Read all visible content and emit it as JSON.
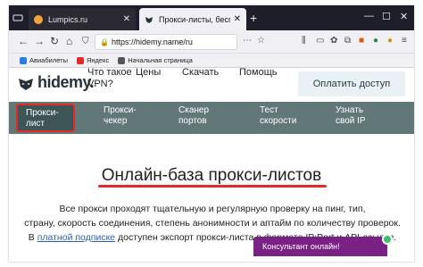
{
  "browser": {
    "tabs": [
      {
        "title": "Lumpics.ru",
        "favicon_color": "#f2a33a",
        "active": false
      },
      {
        "title": "Прокси-листы, бесплатный",
        "favicon_color": "#25323a",
        "active": true
      }
    ],
    "address": "https://hidemy.name/ru",
    "bookmarks": [
      {
        "label": "Авиабилеты",
        "icon_color": "#2a7de1"
      },
      {
        "label": "Яндекс",
        "icon_color": "#e02b2b"
      },
      {
        "label": "Начальная страница",
        "icon_color": "#555555"
      }
    ]
  },
  "site": {
    "logo_text": "hidemy.",
    "nav": [
      "Что такое VPN?",
      "Цены",
      "Скачать",
      "Помощь"
    ],
    "cta": "Оплатить доступ",
    "menu": [
      {
        "label": "Прокси-\nлист",
        "active": true
      },
      {
        "label": "Прокси-\nчекер",
        "active": false
      },
      {
        "label": "Сканер\nпортов",
        "active": false
      },
      {
        "label": "Тест\nскорости",
        "active": false
      },
      {
        "label": "Узнать\nсвой IP",
        "active": false
      }
    ],
    "hero_title": "Онлайн-база прокси-листов",
    "body_line1": "Все прокси проходят тщательную и регулярную проверку на пинг, тип,",
    "body_line2": "страну, скорость соединения, степень анонимности и аптайм по количеству проверок.",
    "body_line3_prefix": "В ",
    "body_line3_link": "платной подписке",
    "body_line3_suffix": " доступен экспорт прокси-листа в формате IP:Port и API-ссылке.",
    "chat_label": "Консультант онлайн!"
  },
  "colors": {
    "menu_bg": "#627878",
    "active_border": "#e02b2b",
    "underline": "#e02b2b",
    "chat_bg": "#7a2185",
    "link": "#2a62b8"
  }
}
